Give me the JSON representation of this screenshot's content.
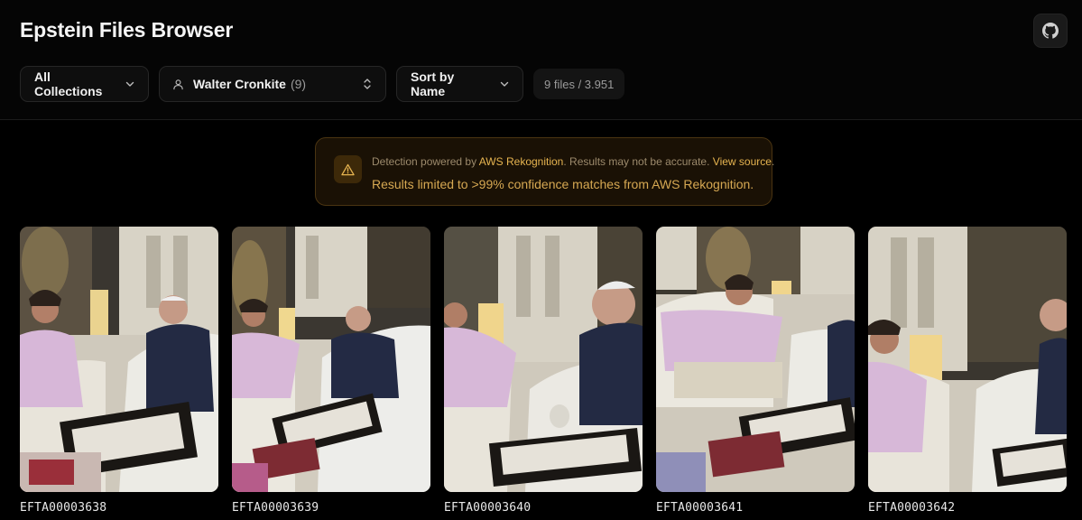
{
  "app": {
    "title": "Epstein Files Browser",
    "github_icon": "github-icon"
  },
  "filters": {
    "collection": {
      "label": "All Collections"
    },
    "person": {
      "name": "Walter Cronkite",
      "count": "(9)"
    },
    "sort": {
      "label": "Sort by Name"
    },
    "files_count": "9 files / 3.951"
  },
  "notice": {
    "prefix": "Detection powered by ",
    "provider": "AWS Rekognition",
    "middle": ". Results may not be accurate. ",
    "link": "View source",
    "suffix": ".",
    "detail": "Results limited to >99% confidence matches from AWS Rekognition."
  },
  "photos": [
    {
      "id": "EFTA00003638"
    },
    {
      "id": "EFTA00003639"
    },
    {
      "id": "EFTA00003640"
    },
    {
      "id": "EFTA00003641"
    },
    {
      "id": "EFTA00003642"
    }
  ],
  "colors": {
    "background": "#000000",
    "accent_warning": "#e6b450",
    "notice_bg": "#1a1105"
  }
}
